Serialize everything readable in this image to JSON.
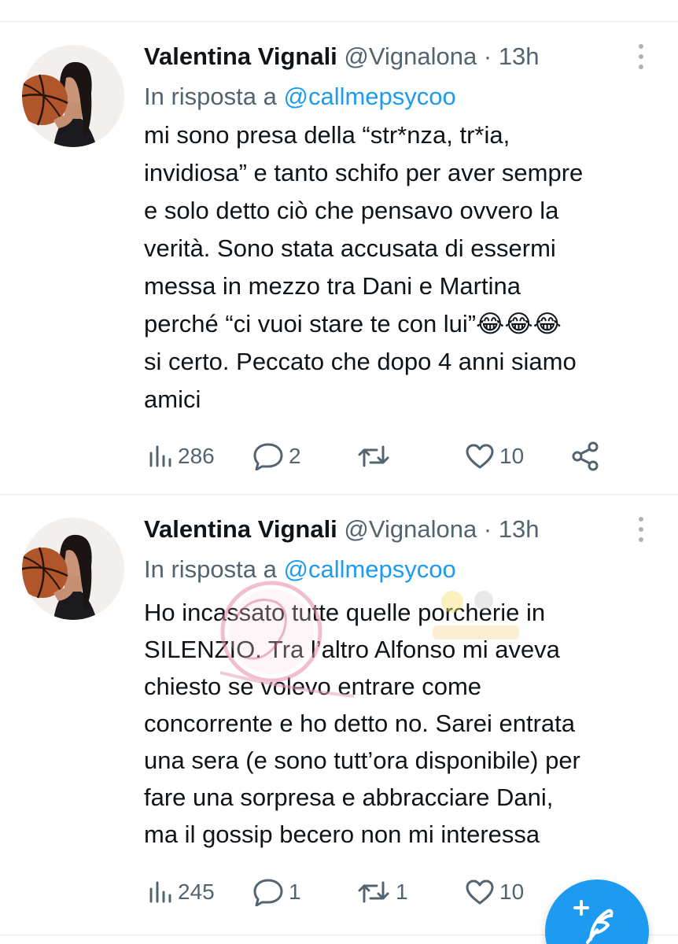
{
  "tweets": [
    {
      "author_name": "Valentina Vignali",
      "handle": "@Vignalona",
      "separator": "·",
      "time": "13h",
      "reply_label": "In risposta a",
      "reply_mention": "@callmepsycoo",
      "lines": [
        "mi sono presa della “str*nza, tr*ia,",
        "invidiosa” e tanto schifo per aver sempre",
        "e solo detto ciò che pensavo ovvero la",
        "verità. Sono stata accusata di essermi",
        "messa in mezzo tra Dani e Martina",
        "perché “ci vuoi stare te con lui”😂😂😂",
        "si certo. Peccato che dopo 4 anni siamo",
        "amici"
      ],
      "views": "286",
      "replies": "2",
      "retweets": "",
      "likes": "10"
    },
    {
      "author_name": "Valentina Vignali",
      "handle": "@Vignalona",
      "separator": "·",
      "time": "13h",
      "reply_label": "In risposta a",
      "reply_mention": "@callmepsycoo",
      "lines": [
        "Ho incassato tutte quelle porcherie in",
        "SILENZIO. Tra l’altro Alfonso mi aveva",
        "chiesto se volevo entrare come",
        "concorrente e ho detto no. Sarei entrata",
        "una sera (e sono tutt’ora disponibile) per",
        "fare una sorpresa e abbracciare Dani,",
        "ma il gossip becero non mi interessa"
      ],
      "views": "245",
      "replies": "1",
      "retweets": "1",
      "likes": "10"
    }
  ],
  "icons": {
    "views": "bar-chart-icon",
    "reply": "speech-bubble-icon",
    "retweet": "retweet-icon",
    "like": "heart-icon",
    "share": "share-icon",
    "more": "more-vertical-icon",
    "compose": "compose-feather-icon"
  },
  "colors": {
    "accent": "#1d9bf0",
    "text": "#0f1419",
    "secondary": "#536471",
    "divider": "#e6e9eb"
  }
}
